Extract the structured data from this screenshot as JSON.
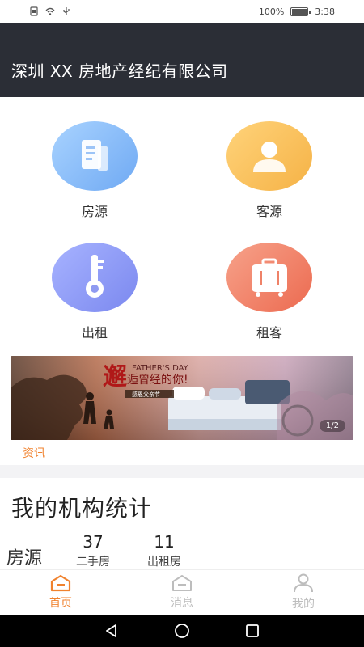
{
  "status_bar": {
    "battery_text": "100%",
    "time": "3:38"
  },
  "header": {
    "title": "深圳 XX  房地产经纪有限公司"
  },
  "grid": [
    {
      "label": "房源",
      "icon": "document-icon",
      "color": "#6fa9f3"
    },
    {
      "label": "客源",
      "icon": "person-icon",
      "color": "#f5b246"
    },
    {
      "label": "出租",
      "icon": "key-icon",
      "color": "#7b88ef"
    },
    {
      "label": "租客",
      "icon": "suitcase-icon",
      "color": "#ec6a50"
    }
  ],
  "banner": {
    "headline_big": "邂",
    "headline_small": "逅曾经的你!",
    "english": "FATHER'S DAY",
    "sub": "感恩父亲节",
    "pager": "1/2"
  },
  "news_link": "资讯",
  "stats": {
    "title": "我的机构统计",
    "row_label": "房源",
    "items": [
      {
        "value": "37",
        "label": "二手房"
      },
      {
        "value": "11",
        "label": "出租房"
      }
    ]
  },
  "tabbar": [
    {
      "label": "首页",
      "active": true,
      "icon": "home-icon"
    },
    {
      "label": "消息",
      "active": false,
      "icon": "message-icon"
    },
    {
      "label": "我的",
      "active": false,
      "icon": "profile-icon"
    }
  ],
  "colors": {
    "accent": "#f0822e",
    "header_bg": "#2b2e36"
  }
}
